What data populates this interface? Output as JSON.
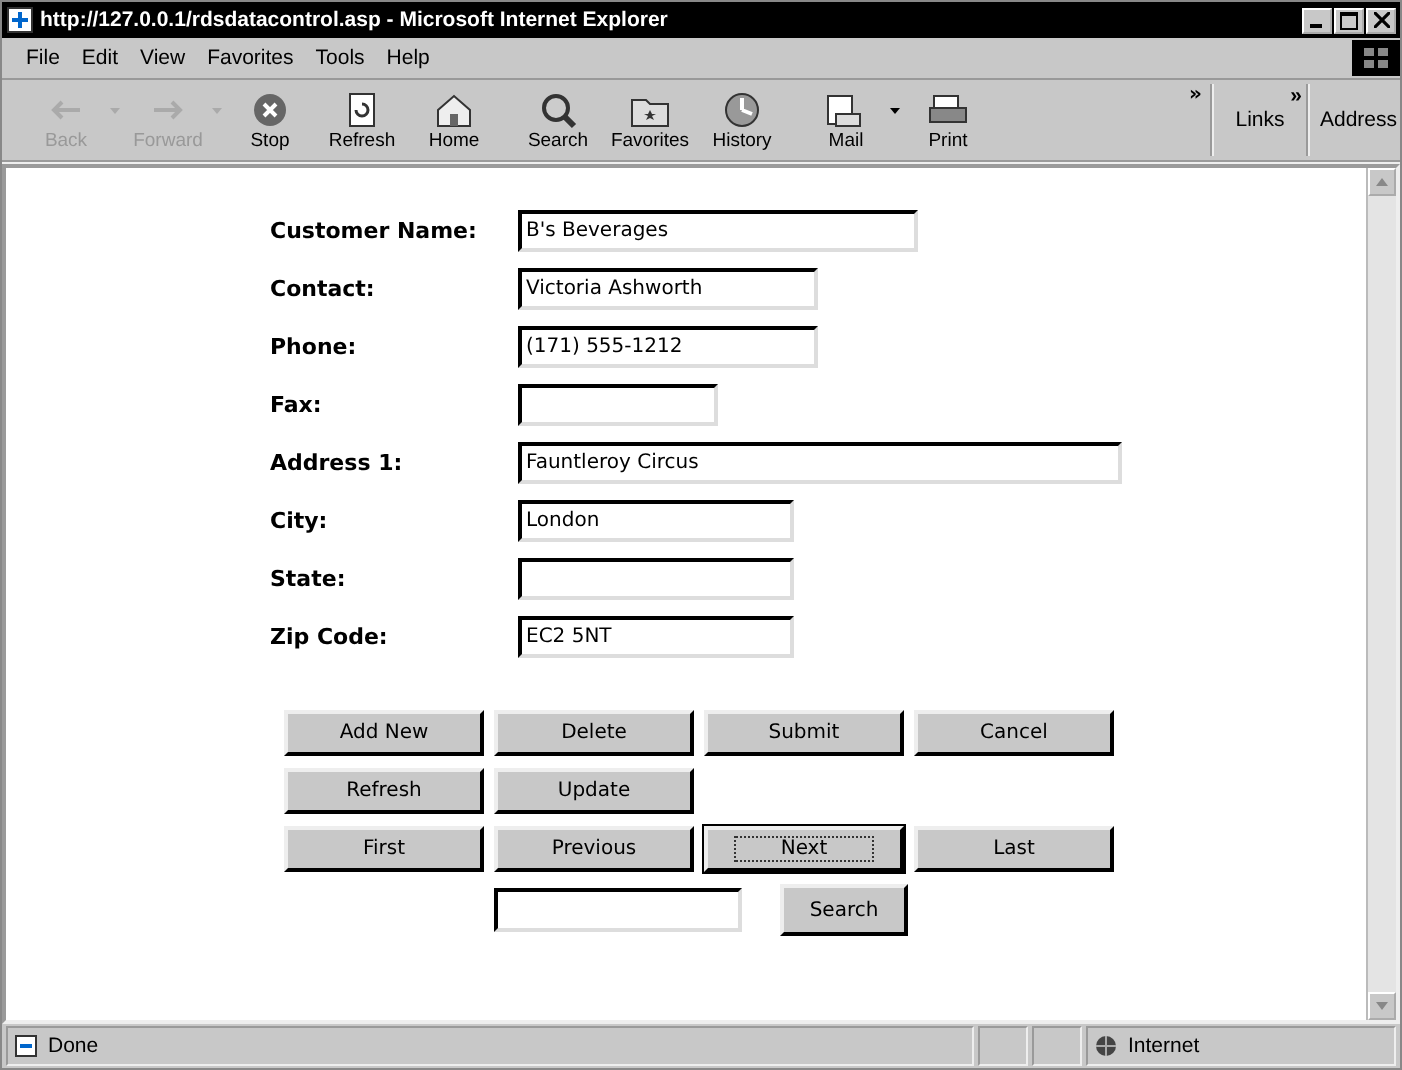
{
  "window": {
    "title": "http://127.0.0.1/rdsdatacontrol.asp - Microsoft Internet Explorer"
  },
  "menu": [
    "File",
    "Edit",
    "View",
    "Favorites",
    "Tools",
    "Help"
  ],
  "toolbar": [
    {
      "label": "Back",
      "kind": "back",
      "disabled": true,
      "dropdown": true
    },
    {
      "label": "Forward",
      "kind": "forward",
      "disabled": true,
      "dropdown": true
    },
    {
      "label": "Stop",
      "kind": "stop",
      "disabled": false,
      "dropdown": false
    },
    {
      "label": "Refresh",
      "kind": "refresh",
      "disabled": false,
      "dropdown": false
    },
    {
      "label": "Home",
      "kind": "home",
      "disabled": false,
      "dropdown": false
    },
    {
      "label": "Search",
      "kind": "search",
      "disabled": false,
      "dropdown": false
    },
    {
      "label": "Favorites",
      "kind": "favorites",
      "disabled": false,
      "dropdown": false
    },
    {
      "label": "History",
      "kind": "history",
      "disabled": false,
      "dropdown": false
    },
    {
      "label": "Mail",
      "kind": "mail",
      "disabled": false,
      "dropdown": true
    },
    {
      "label": "Print",
      "kind": "print",
      "disabled": false,
      "dropdown": false
    }
  ],
  "more": "»",
  "links": {
    "label": "Links",
    "more": "»"
  },
  "address": {
    "label": "Address"
  },
  "form": [
    {
      "label": "Customer Name:",
      "value": "B's Beverages"
    },
    {
      "label": "Contact:",
      "value": "Victoria Ashworth"
    },
    {
      "label": "Phone:",
      "value": "(171) 555-1212"
    },
    {
      "label": "Fax:"
    },
    {
      "label": "Address 1:",
      "value": "Fauntleroy Circus"
    },
    {
      "label": "City:",
      "value": "London"
    },
    {
      "label": "State:"
    },
    {
      "label": "Zip Code:",
      "value": "EC2 5NT"
    }
  ],
  "button_rows": [
    [
      {
        "label": "Add New",
        "focused": false
      },
      {
        "label": "Delete",
        "focused": false
      },
      {
        "label": "Submit",
        "focused": false
      },
      {
        "label": "Cancel",
        "focused": false
      }
    ],
    [
      {
        "label": "Refresh",
        "focused": false
      },
      {
        "label": "Update",
        "focused": false
      }
    ],
    [
      {
        "label": "First",
        "focused": false
      },
      {
        "label": "Previous",
        "focused": false
      },
      {
        "label": "Next",
        "focused": true
      },
      {
        "label": "Last",
        "focused": false
      }
    ]
  ],
  "search": {
    "button": "Search"
  },
  "status_bar": {
    "text": "Done",
    "zone": "Internet"
  }
}
